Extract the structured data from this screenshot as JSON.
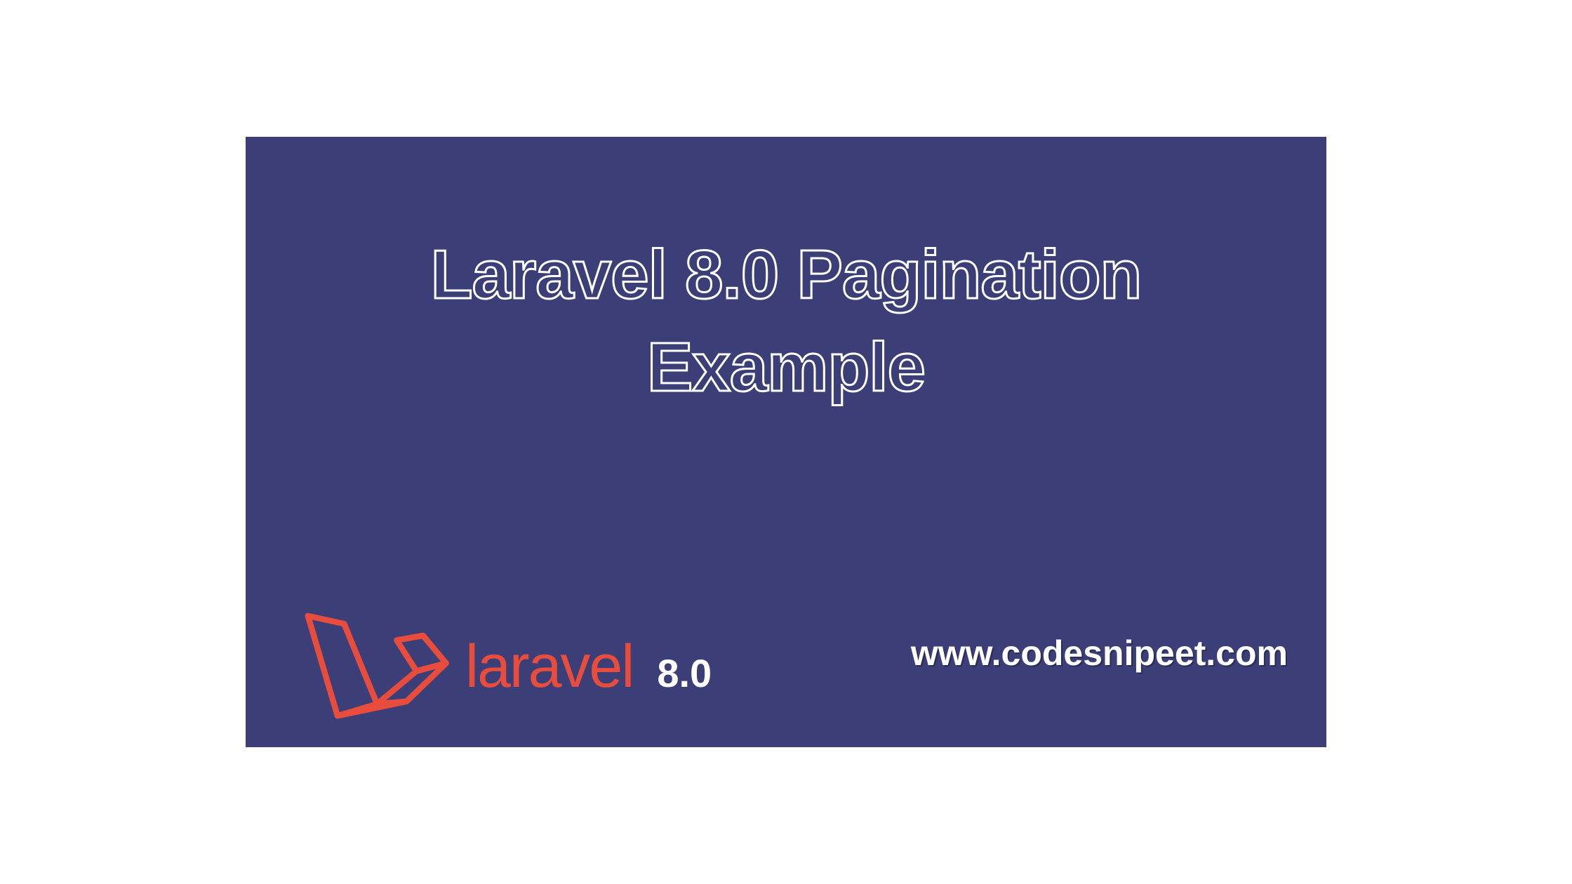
{
  "title": {
    "line1": "Laravel 8.0 Pagination",
    "line2": "Example"
  },
  "brand": {
    "name": "laravel",
    "version": "8.0",
    "logoColor": "#e74c3c"
  },
  "website": "www.codesnipeet.com",
  "colors": {
    "background": "#3c3f77",
    "accent": "#e74c3c",
    "text": "#ffffff"
  }
}
